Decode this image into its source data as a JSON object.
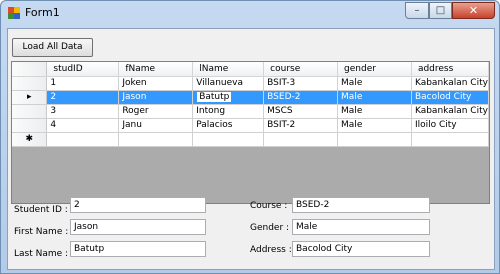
{
  "window": {
    "title": "Form1"
  },
  "controls": {
    "minimize": "–",
    "maximize": "□",
    "close": "✕"
  },
  "toolbar": {
    "load_label": "Load All Data"
  },
  "grid": {
    "columns": [
      "studID",
      "fName",
      "lName",
      "course",
      "gender",
      "address"
    ],
    "rows": [
      {
        "marker": "",
        "cells": [
          "1",
          "Joken",
          "Villanueva",
          "BSIT-3",
          "Male",
          "Kabankalan City"
        ]
      },
      {
        "marker": "▸",
        "cells": [
          "2",
          "Jason",
          "Batutp",
          "BSED-2",
          "Male",
          "Bacolod City"
        ]
      },
      {
        "marker": "",
        "cells": [
          "3",
          "Roger",
          "Intong",
          "MSCS",
          "Male",
          "Kabankalan City"
        ]
      },
      {
        "marker": "",
        "cells": [
          "4",
          "Janu",
          "Palacios",
          "BSIT-2",
          "Male",
          "Iloilo City"
        ]
      }
    ],
    "new_row_marker": "✱"
  },
  "form": {
    "student_id_label": "Student ID :",
    "student_id_value": "2",
    "first_name_label": "First Name :",
    "first_name_value": "Jason",
    "last_name_label": "Last Name :",
    "last_name_value": "Batutp",
    "course_label": "Course :",
    "course_value": "BSED-2",
    "gender_label": "Gender :",
    "gender_value": "Male",
    "address_label": "Address :",
    "address_value": "Bacolod City"
  }
}
